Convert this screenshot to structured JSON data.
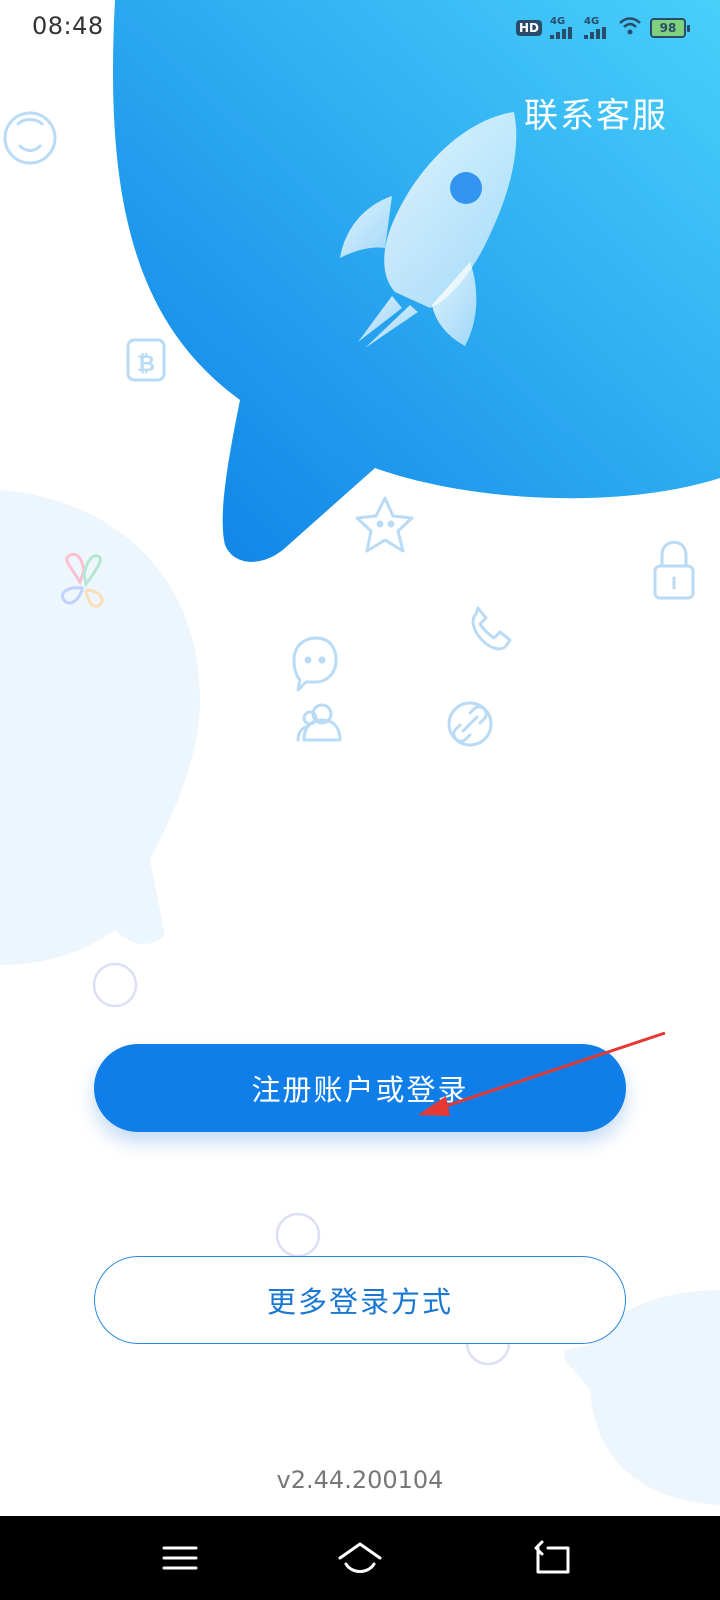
{
  "status_bar": {
    "time": "08:48",
    "battery": "98",
    "network": "4G",
    "hd_label": "HD"
  },
  "header": {
    "contact_label": "联系客服"
  },
  "actions": {
    "primary_label": "注册账户或登录",
    "secondary_label": "更多登录方式"
  },
  "footer": {
    "version": "v2.44.200104"
  },
  "icons": {
    "hero": "rocket-icon",
    "decor": [
      "face-icon",
      "bitcoin-icon",
      "clover-icon",
      "star-icon",
      "lock-icon",
      "phone-icon",
      "chat-bubble-icon",
      "users-icon",
      "link-icon"
    ],
    "nav": [
      "menu-icon",
      "home-icon",
      "back-icon"
    ]
  },
  "colors": {
    "accent": "#0f7ee8",
    "bubble_start": "#1a86ec",
    "bubble_end": "#47cdf9",
    "outline_text": "#1a78d2",
    "annotation_arrow": "#e53935"
  }
}
